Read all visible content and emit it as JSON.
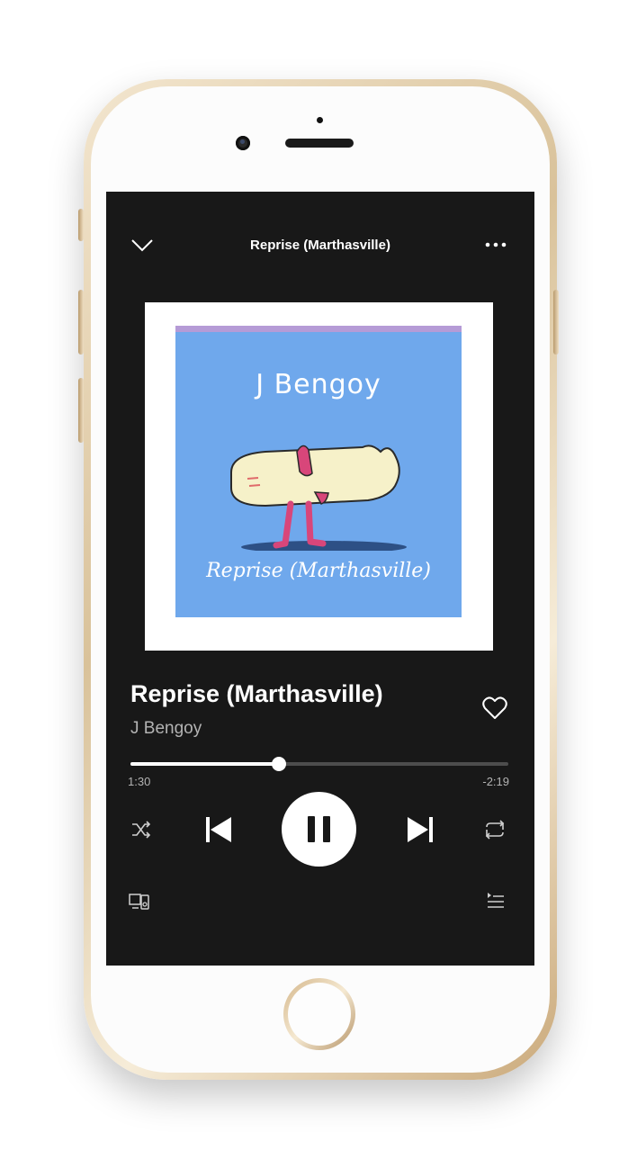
{
  "header": {
    "title": "Reprise (Marthasville)",
    "collapse_icon": "chevron-down-icon",
    "menu_icon": "more-icon"
  },
  "album_art": {
    "artist_text": "J Bengoy",
    "title_text": "Reprise (Marthasville)",
    "background_color": "#6fa8ec"
  },
  "track": {
    "title": "Reprise (Marthasville)",
    "artist": "J Bengoy",
    "liked": false
  },
  "progress": {
    "elapsed": "1:30",
    "remaining": "-2:19",
    "fraction": 0.394
  },
  "controls": {
    "shuffle_icon": "shuffle-icon",
    "previous_icon": "previous-icon",
    "play_state": "playing",
    "next_icon": "next-icon",
    "repeat_icon": "repeat-icon",
    "devices_icon": "devices-icon",
    "queue_icon": "queue-icon"
  },
  "colors": {
    "background": "#181818",
    "primary_text": "#ffffff",
    "secondary_text": "#b3b3b3",
    "progress_track": "#4d4d4d"
  }
}
